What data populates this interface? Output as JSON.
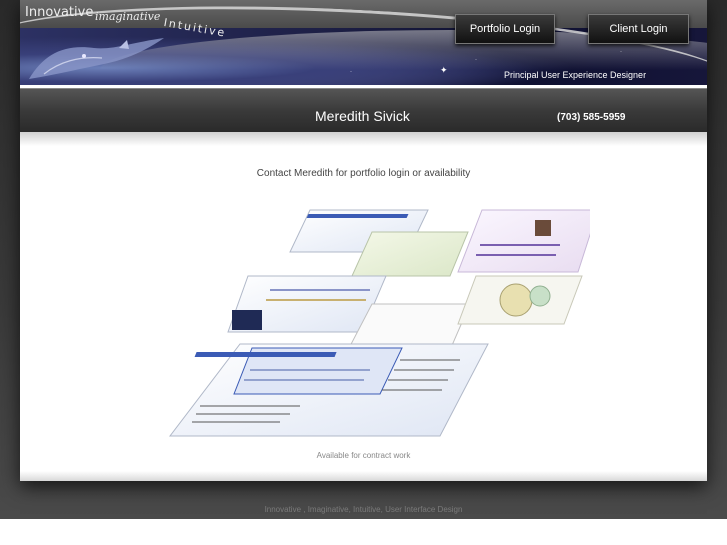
{
  "header": {
    "tagline_words": [
      "Innovative",
      "imaginative",
      "Intuitive"
    ],
    "role_title": "Principal User Experience Designer",
    "buttons": {
      "portfolio_login": "Portfolio Login",
      "client_login": "Client Login"
    }
  },
  "name_bar": {
    "name": "Meredith Sivick",
    "phone": "(703) 585-5959"
  },
  "main": {
    "contact_message": "Contact Meredith for portfolio login or availability",
    "collage_icon": "portfolio-screenshots-collage",
    "availability": "Available for contract work"
  },
  "footer": {
    "text": "Innovative , Imaginative, Intuitive, User Interface Design"
  },
  "colors": {
    "banner_dark": "#222222",
    "button_bg": "#111111",
    "accent_blue": "#3b5bb5"
  }
}
